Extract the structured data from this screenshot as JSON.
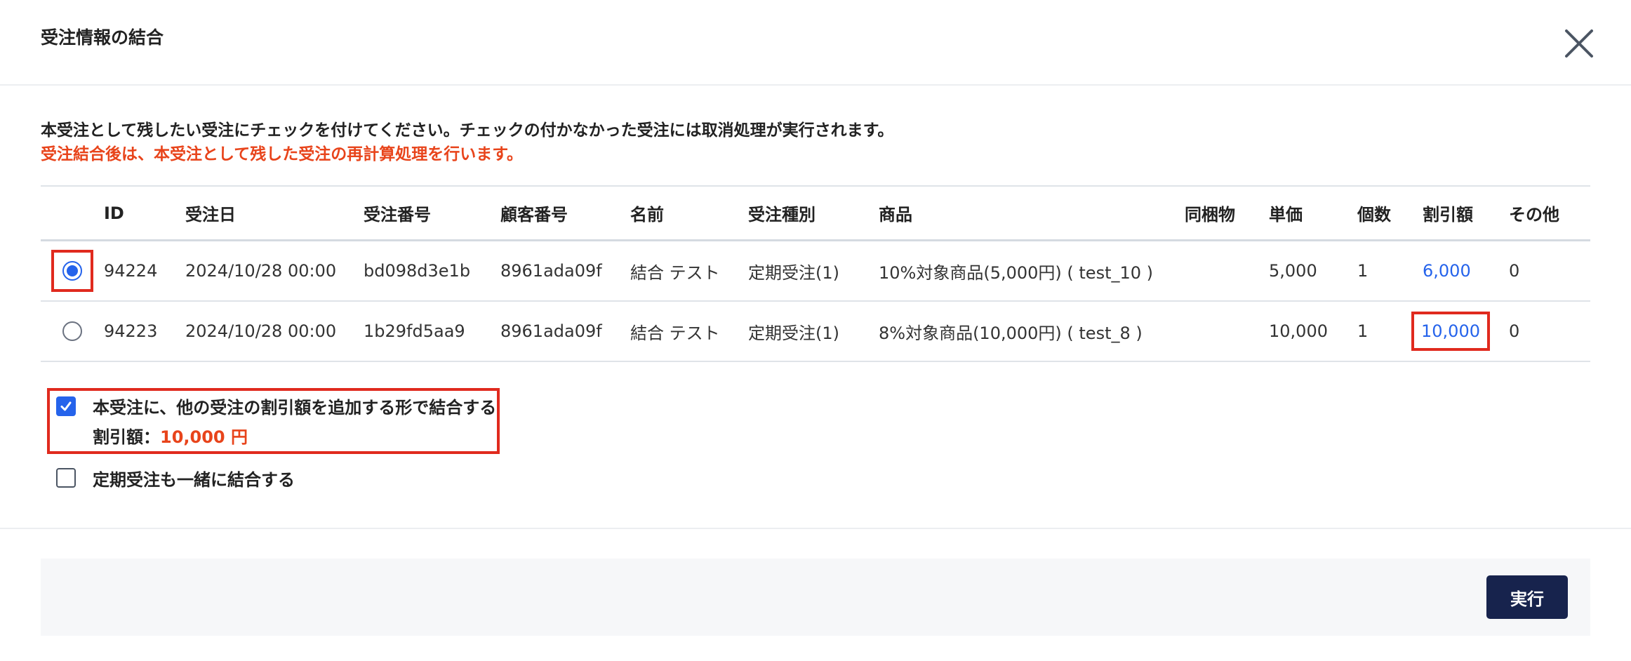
{
  "dialog": {
    "title": "受注情報の結合",
    "instruction": "本受注として残したい受注にチェックを付けてください。チェックの付かなかった受注には取消処理が実行されます。",
    "warning": "受注結合後は、本受注として残した受注の再計算処理を行います。"
  },
  "table": {
    "headers": {
      "id": "ID",
      "order_date": "受注日",
      "order_number": "受注番号",
      "customer_number": "顧客番号",
      "name": "名前",
      "order_type": "受注種別",
      "product": "商品",
      "bundled": "同梱物",
      "unit_price": "単価",
      "quantity": "個数",
      "discount": "割引額",
      "other": "その他"
    },
    "rows": [
      {
        "selected": true,
        "id": "94224",
        "order_date": "2024/10/28 00:00",
        "order_number": "bd098d3e1b",
        "customer_number": "8961ada09f",
        "name": "結合 テスト",
        "order_type": "定期受注(1)",
        "product": "10%対象商品(5,000円) ( test_10 )",
        "bundled": "",
        "unit_price": "5,000",
        "quantity": "1",
        "discount": "6,000",
        "other": "0"
      },
      {
        "selected": false,
        "id": "94223",
        "order_date": "2024/10/28 00:00",
        "order_number": "1b29fd5aa9",
        "customer_number": "8961ada09f",
        "name": "結合 テスト",
        "order_type": "定期受注(1)",
        "product": "8%対象商品(10,000円) ( test_8 )",
        "bundled": "",
        "unit_price": "10,000",
        "quantity": "1",
        "discount": "10,000",
        "other": "0"
      }
    ]
  },
  "options": {
    "merge_discount": {
      "checked": true,
      "label": "本受注に、他の受注の割引額を追加する形で結合する",
      "discount_label": "割引額：",
      "discount_amount": "10,000 円"
    },
    "merge_subscription": {
      "checked": false,
      "label": "定期受注も一緒に結合する"
    }
  },
  "footer": {
    "execute_label": "実行"
  },
  "colors": {
    "accent_blue": "#2563eb",
    "highlight_red": "#e02a1e",
    "warning_orange": "#e8441b",
    "button_navy": "#17234d"
  }
}
